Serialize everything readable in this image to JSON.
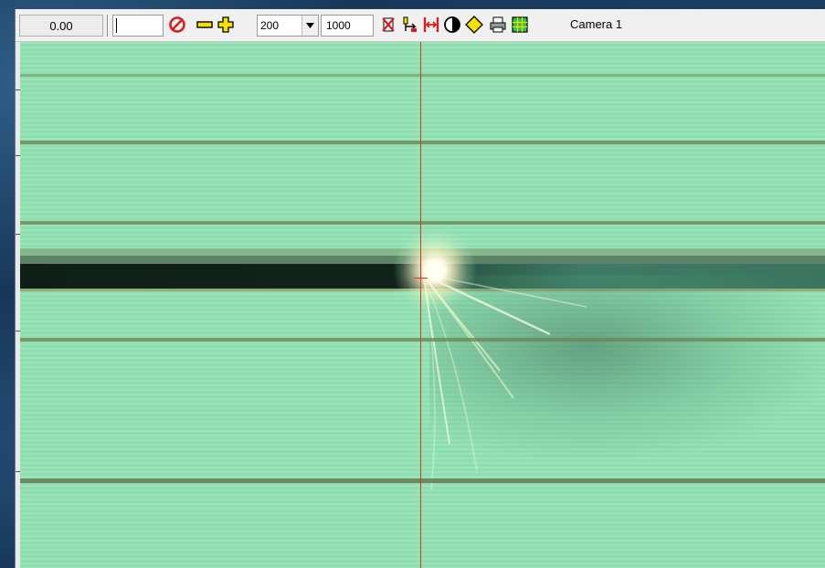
{
  "toolbar": {
    "time_value": "0.00",
    "text_value": "",
    "zoom_value": "200",
    "frame_count": "1000",
    "camera_label": "Camera 1"
  },
  "icons": {
    "stop": "no-entry-icon",
    "zoom_out": "minus-icon",
    "zoom_in": "plus-icon",
    "dropdown": "chevron-down-icon",
    "clear": "delete-cross-icon",
    "sync": "sync-icon",
    "measure": "measure-icon",
    "contrast": "contrast-icon",
    "marker": "diamond-marker-icon",
    "print": "printer-icon",
    "grid": "grid-icon"
  },
  "colors": {
    "image_green": "#93e2b4",
    "cursor_red": "#d13a1a",
    "stop_red": "#d42020",
    "icon_yellow": "#f5e000"
  }
}
